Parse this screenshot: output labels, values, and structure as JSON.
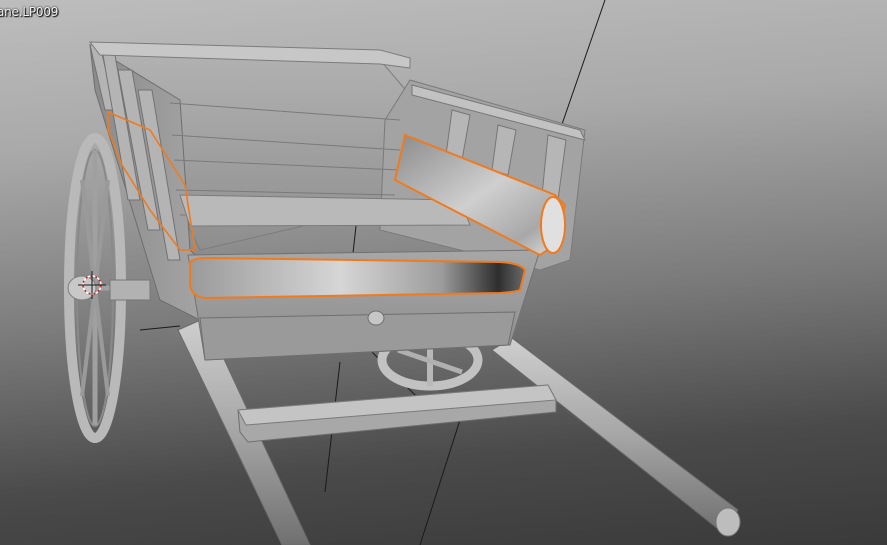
{
  "viewport": {
    "object_name": "ane.LP009",
    "selection_color": "#f07a1e",
    "background_top": "#bdbdbd",
    "background_bottom": "#3a3a3a",
    "model": "cart-3d-model",
    "cursor": "3d-cursor-icon"
  }
}
